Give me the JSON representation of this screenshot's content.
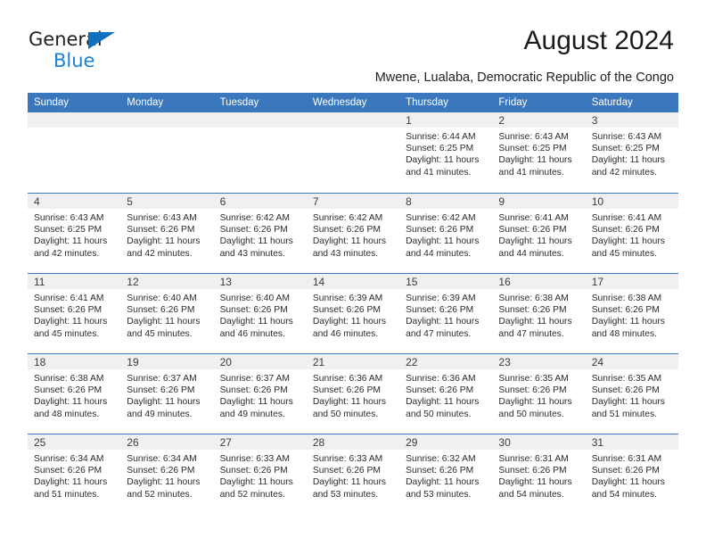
{
  "brand": {
    "name_top": "General",
    "name_bottom": "Blue",
    "triangle_color": "#1170bd",
    "blue_color": "#1c82d4"
  },
  "header": {
    "month_title": "August 2024",
    "location": "Mwene, Lualaba, Democratic Republic of the Congo"
  },
  "theme": {
    "header_blue": "#3b77bd",
    "daynum_band": "#f0f0f0",
    "row_rule": "#3b77bd"
  },
  "calendar": {
    "weekdays": [
      "Sunday",
      "Monday",
      "Tuesday",
      "Wednesday",
      "Thursday",
      "Friday",
      "Saturday"
    ],
    "weeks": [
      [
        {
          "day": "",
          "text": ""
        },
        {
          "day": "",
          "text": ""
        },
        {
          "day": "",
          "text": ""
        },
        {
          "day": "",
          "text": ""
        },
        {
          "day": "1",
          "text": "Sunrise: 6:44 AM\nSunset: 6:25 PM\nDaylight: 11 hours\nand 41 minutes."
        },
        {
          "day": "2",
          "text": "Sunrise: 6:43 AM\nSunset: 6:25 PM\nDaylight: 11 hours\nand 41 minutes."
        },
        {
          "day": "3",
          "text": "Sunrise: 6:43 AM\nSunset: 6:25 PM\nDaylight: 11 hours\nand 42 minutes."
        }
      ],
      [
        {
          "day": "4",
          "text": "Sunrise: 6:43 AM\nSunset: 6:25 PM\nDaylight: 11 hours\nand 42 minutes."
        },
        {
          "day": "5",
          "text": "Sunrise: 6:43 AM\nSunset: 6:26 PM\nDaylight: 11 hours\nand 42 minutes."
        },
        {
          "day": "6",
          "text": "Sunrise: 6:42 AM\nSunset: 6:26 PM\nDaylight: 11 hours\nand 43 minutes."
        },
        {
          "day": "7",
          "text": "Sunrise: 6:42 AM\nSunset: 6:26 PM\nDaylight: 11 hours\nand 43 minutes."
        },
        {
          "day": "8",
          "text": "Sunrise: 6:42 AM\nSunset: 6:26 PM\nDaylight: 11 hours\nand 44 minutes."
        },
        {
          "day": "9",
          "text": "Sunrise: 6:41 AM\nSunset: 6:26 PM\nDaylight: 11 hours\nand 44 minutes."
        },
        {
          "day": "10",
          "text": "Sunrise: 6:41 AM\nSunset: 6:26 PM\nDaylight: 11 hours\nand 45 minutes."
        }
      ],
      [
        {
          "day": "11",
          "text": "Sunrise: 6:41 AM\nSunset: 6:26 PM\nDaylight: 11 hours\nand 45 minutes."
        },
        {
          "day": "12",
          "text": "Sunrise: 6:40 AM\nSunset: 6:26 PM\nDaylight: 11 hours\nand 45 minutes."
        },
        {
          "day": "13",
          "text": "Sunrise: 6:40 AM\nSunset: 6:26 PM\nDaylight: 11 hours\nand 46 minutes."
        },
        {
          "day": "14",
          "text": "Sunrise: 6:39 AM\nSunset: 6:26 PM\nDaylight: 11 hours\nand 46 minutes."
        },
        {
          "day": "15",
          "text": "Sunrise: 6:39 AM\nSunset: 6:26 PM\nDaylight: 11 hours\nand 47 minutes."
        },
        {
          "day": "16",
          "text": "Sunrise: 6:38 AM\nSunset: 6:26 PM\nDaylight: 11 hours\nand 47 minutes."
        },
        {
          "day": "17",
          "text": "Sunrise: 6:38 AM\nSunset: 6:26 PM\nDaylight: 11 hours\nand 48 minutes."
        }
      ],
      [
        {
          "day": "18",
          "text": "Sunrise: 6:38 AM\nSunset: 6:26 PM\nDaylight: 11 hours\nand 48 minutes."
        },
        {
          "day": "19",
          "text": "Sunrise: 6:37 AM\nSunset: 6:26 PM\nDaylight: 11 hours\nand 49 minutes."
        },
        {
          "day": "20",
          "text": "Sunrise: 6:37 AM\nSunset: 6:26 PM\nDaylight: 11 hours\nand 49 minutes."
        },
        {
          "day": "21",
          "text": "Sunrise: 6:36 AM\nSunset: 6:26 PM\nDaylight: 11 hours\nand 50 minutes."
        },
        {
          "day": "22",
          "text": "Sunrise: 6:36 AM\nSunset: 6:26 PM\nDaylight: 11 hours\nand 50 minutes."
        },
        {
          "day": "23",
          "text": "Sunrise: 6:35 AM\nSunset: 6:26 PM\nDaylight: 11 hours\nand 50 minutes."
        },
        {
          "day": "24",
          "text": "Sunrise: 6:35 AM\nSunset: 6:26 PM\nDaylight: 11 hours\nand 51 minutes."
        }
      ],
      [
        {
          "day": "25",
          "text": "Sunrise: 6:34 AM\nSunset: 6:26 PM\nDaylight: 11 hours\nand 51 minutes."
        },
        {
          "day": "26",
          "text": "Sunrise: 6:34 AM\nSunset: 6:26 PM\nDaylight: 11 hours\nand 52 minutes."
        },
        {
          "day": "27",
          "text": "Sunrise: 6:33 AM\nSunset: 6:26 PM\nDaylight: 11 hours\nand 52 minutes."
        },
        {
          "day": "28",
          "text": "Sunrise: 6:33 AM\nSunset: 6:26 PM\nDaylight: 11 hours\nand 53 minutes."
        },
        {
          "day": "29",
          "text": "Sunrise: 6:32 AM\nSunset: 6:26 PM\nDaylight: 11 hours\nand 53 minutes."
        },
        {
          "day": "30",
          "text": "Sunrise: 6:31 AM\nSunset: 6:26 PM\nDaylight: 11 hours\nand 54 minutes."
        },
        {
          "day": "31",
          "text": "Sunrise: 6:31 AM\nSunset: 6:26 PM\nDaylight: 11 hours\nand 54 minutes."
        }
      ]
    ]
  }
}
